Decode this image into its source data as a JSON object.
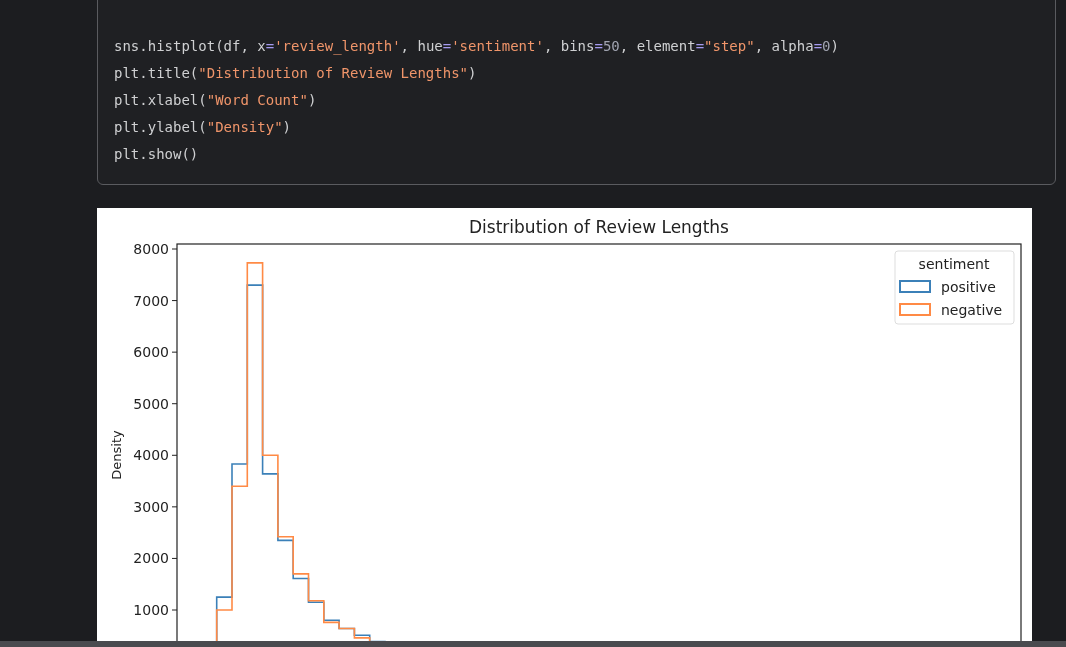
{
  "code_block": {
    "lines": [
      [
        {
          "kind": "plain",
          "text": "sns.histplot(df, x"
        },
        {
          "kind": "op",
          "text": "="
        },
        {
          "kind": "string",
          "text": "'review_length'"
        },
        {
          "kind": "plain",
          "text": ", hue"
        },
        {
          "kind": "op",
          "text": "="
        },
        {
          "kind": "string",
          "text": "'sentiment'"
        },
        {
          "kind": "plain",
          "text": ", bins"
        },
        {
          "kind": "op",
          "text": "="
        },
        {
          "kind": "number",
          "text": "50"
        },
        {
          "kind": "plain",
          "text": ", element"
        },
        {
          "kind": "op",
          "text": "="
        },
        {
          "kind": "string",
          "text": "\"step\""
        },
        {
          "kind": "plain",
          "text": ", alpha"
        },
        {
          "kind": "op",
          "text": "="
        },
        {
          "kind": "number",
          "text": "0"
        },
        {
          "kind": "plain",
          "text": ")"
        }
      ],
      [
        {
          "kind": "plain",
          "text": "plt.title("
        },
        {
          "kind": "string",
          "text": "\"Distribution of Review Lengths\""
        },
        {
          "kind": "plain",
          "text": ")"
        }
      ],
      [
        {
          "kind": "plain",
          "text": "plt.xlabel("
        },
        {
          "kind": "string",
          "text": "\"Word Count\""
        },
        {
          "kind": "plain",
          "text": ")"
        }
      ],
      [
        {
          "kind": "plain",
          "text": "plt.ylabel("
        },
        {
          "kind": "string",
          "text": "\"Density\""
        },
        {
          "kind": "plain",
          "text": ")"
        }
      ],
      [
        {
          "kind": "plain",
          "text": "plt.show()"
        }
      ]
    ]
  },
  "figure": {
    "title": "Distribution of Review Lengths",
    "ylabel": "Density",
    "y_tick_labels": [
      "8000",
      "7000",
      "6000",
      "5000",
      "4000",
      "3000",
      "2000",
      "1000"
    ],
    "legend": {
      "title": "sentiment",
      "entries": [
        {
          "label": "positive",
          "color": "#3b80b8"
        },
        {
          "label": "negative",
          "color": "#ff8a45"
        }
      ]
    }
  }
}
